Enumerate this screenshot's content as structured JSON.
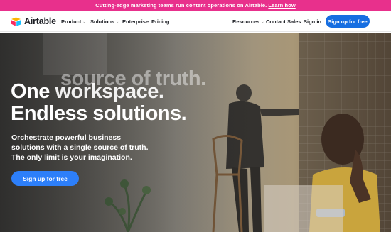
{
  "promo": {
    "text": "Cutting-edge marketing teams run content operations on Airtable.",
    "link": "Learn how"
  },
  "nav": {
    "logo_text": "Airtable",
    "items": [
      {
        "label": "Product",
        "dropdown": true
      },
      {
        "label": "Solutions",
        "dropdown": true
      },
      {
        "label": "Enterprise",
        "dropdown": false
      },
      {
        "label": "Pricing",
        "dropdown": false
      }
    ],
    "right_items": [
      {
        "label": "Resources",
        "dropdown": true
      },
      {
        "label": "Contact Sales",
        "dropdown": false
      },
      {
        "label": "Sign in",
        "dropdown": false
      }
    ],
    "signup": "Sign up for free",
    "chevron": "⌄"
  },
  "hero": {
    "ghost_line": "source of truth.",
    "headline_line1_a": "One",
    "headline_line1_b": "workspace.",
    "headline_line2": "Endless solutions.",
    "subtext": "Orchestrate powerful business solutions with a single source of truth. The only limit is your imagination.",
    "cta": "Sign up for free"
  },
  "colors": {
    "promo_bg": "#e8308c",
    "signup_bg": "#166ee1",
    "cta_bg": "#2d7ff9"
  }
}
